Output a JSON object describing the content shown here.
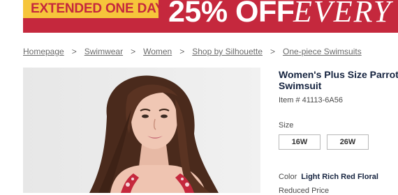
{
  "banner": {
    "badge": "EXTENDED ONE DAY!",
    "offer": "25% OFF",
    "every": "EVERY"
  },
  "breadcrumb": {
    "items": [
      "Homepage",
      "Swimwear",
      "Women",
      "Shop by Silhouette",
      "One-piece Swimsuits"
    ],
    "separator": ">"
  },
  "product": {
    "title": "Women's Plus Size Parrot Swimsuit",
    "item_number": "Item # 41113-6A56",
    "size_label": "Size",
    "sizes": [
      "16W",
      "26W"
    ],
    "color_label": "Color",
    "color_value": "Light Rich Red Floral",
    "price_label": "Reduced Price"
  },
  "colors": {
    "banner_red": "#c5283d",
    "badge_yellow": "#f6c53b",
    "title_navy": "#15233f"
  }
}
